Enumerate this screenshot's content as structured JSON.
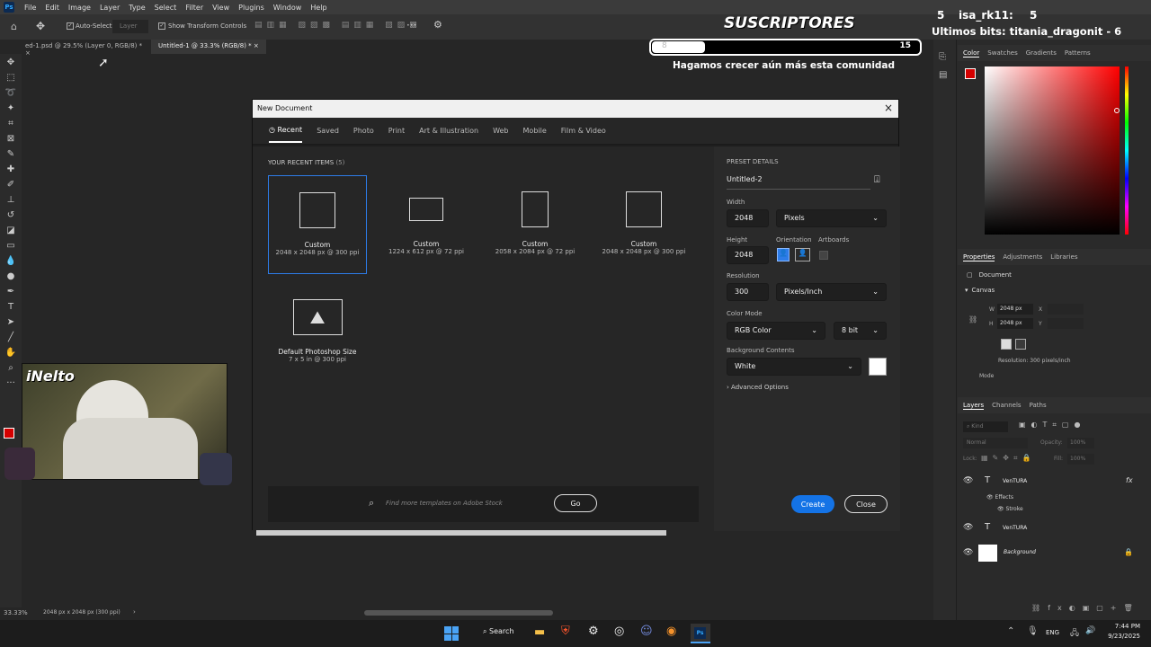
{
  "app": {
    "logo": "Ps"
  },
  "menu": [
    "File",
    "Edit",
    "Image",
    "Layer",
    "Type",
    "Select",
    "Filter",
    "View",
    "Plugins",
    "Window",
    "Help"
  ],
  "options": {
    "autoselect_label": "Auto-Select:",
    "layer_dropdown": "Layer",
    "transform_label": "Show Transform Controls"
  },
  "doc_tabs": [
    {
      "label": "ed-1.psd @ 29.5% (Layer 0, RGB/8) *"
    },
    {
      "label": "Untitled-1 @ 33.3% (RGB/8) *"
    }
  ],
  "overlay": {
    "subs_title": "SUSCRIPTORES",
    "subs_count_left": "5",
    "subs_user": "isa_rk11:",
    "subs_count_right": "5",
    "bits_line": "Ultimos bits: titania_dragonit - 6",
    "progress_left": "8",
    "progress_right": "15",
    "progress_fraction": 0.2,
    "tagline": "Hagamos crecer aún más esta comunidad",
    "webcam_label": "iNelto"
  },
  "dialog": {
    "title": "New Document",
    "categories": [
      "Recent",
      "Saved",
      "Photo",
      "Print",
      "Art & Illustration",
      "Web",
      "Mobile",
      "Film & Video"
    ],
    "recent_heading": "YOUR RECENT ITEMS",
    "recent_count": "(5)",
    "recent": [
      {
        "name": "Custom",
        "desc": "2048 x 2048 px @ 300 ppi"
      },
      {
        "name": "Custom",
        "desc": "1224 x 612 px @ 72 ppi"
      },
      {
        "name": "Custom",
        "desc": "2058 x 2084 px @ 72 ppi"
      },
      {
        "name": "Custom",
        "desc": "2048 x 2048 px @ 300 ppi"
      },
      {
        "name": "Default Photoshop Size",
        "desc": "7 x 5 in @ 300 ppi"
      }
    ],
    "search_placeholder": "Find more templates on Adobe Stock",
    "go_label": "Go",
    "preset": {
      "heading": "PRESET DETAILS",
      "name": "Untitled-2",
      "width_label": "Width",
      "width": "2048",
      "width_unit": "Pixels",
      "height_label": "Height",
      "height": "2048",
      "orientation_label": "Orientation",
      "artboards_label": "Artboards",
      "resolution_label": "Resolution",
      "resolution": "300",
      "resolution_unit": "Pixels/Inch",
      "colormode_label": "Color Mode",
      "colormode": "RGB Color",
      "bitdepth": "8 bit",
      "bg_label": "Background Contents",
      "bg": "White",
      "advanced_label": "Advanced Options"
    },
    "create_label": "Create",
    "close_label": "Close"
  },
  "status": {
    "zoom": "33.33%",
    "docinfo": "2048 px x 2048 px (300 ppi)"
  },
  "panels": {
    "color_tabs": [
      "Color",
      "Swatches",
      "Gradients",
      "Patterns"
    ],
    "props_tabs": [
      "Properties",
      "Adjustments",
      "Libraries"
    ],
    "props_doc": "Document",
    "canvas_label": "Canvas",
    "w_label": "W",
    "w_value": "2048 px",
    "h_label": "H",
    "h_value": "2048 px",
    "x_label": "X",
    "y_label": "Y",
    "resolution_text": "Resolution: 300 pixels/inch",
    "mode_label": "Mode",
    "layers_tabs": [
      "Layers",
      "Channels",
      "Paths"
    ],
    "kind_label": "Kind",
    "blend_mode": "Normal",
    "opacity_label": "Opacity:",
    "opacity": "100%",
    "lock_label": "Lock:",
    "fill_label": "Fill:",
    "fill": "100%",
    "layers": [
      {
        "name": "VenTURA",
        "type": "T"
      },
      {
        "name": "Effects",
        "type": "fx-sub"
      },
      {
        "name": "Stroke",
        "type": "fx-sub2"
      },
      {
        "name": "VenTURA",
        "type": "T"
      },
      {
        "name": "Background",
        "type": "bg"
      }
    ]
  },
  "taskbar": {
    "search_label": "Search",
    "lang": "ENG",
    "time": "7:44 PM",
    "date": "9/23/2025"
  },
  "colors": {
    "accent": "#2d7ce8",
    "fg_swatch": "#d40000",
    "create_btn": "#1473e6"
  }
}
